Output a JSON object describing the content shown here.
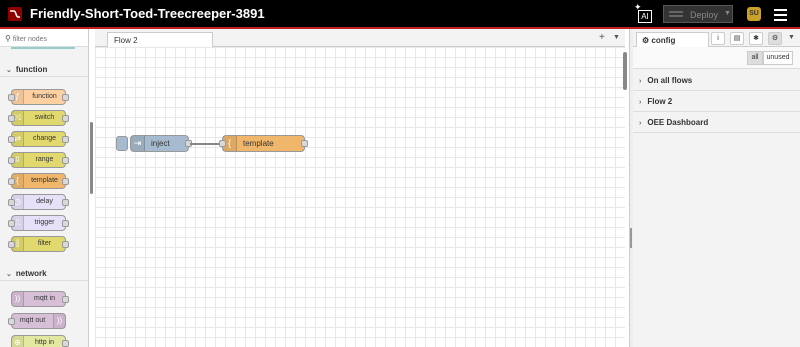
{
  "header": {
    "title": "Friendly-Short-Toed-Treecreeper-3891",
    "ai_label": "AI",
    "deploy_label": "Deploy",
    "user_initials": "SU",
    "accent": "#c02020"
  },
  "palette": {
    "filter_placeholder": "filter nodes",
    "categories": [
      {
        "label": "function",
        "nodes": [
          "function",
          "switch",
          "change",
          "range",
          "template",
          "delay",
          "trigger",
          "filter"
        ]
      },
      {
        "label": "network",
        "nodes": [
          "mqtt in",
          "mqtt out",
          "http in"
        ]
      }
    ],
    "colors": {
      "function": "#fdd0a2",
      "switch": "#e2d96e",
      "template": "#f0b76c",
      "delay": "#e6e0f8",
      "network": "#d8bfd8"
    }
  },
  "workspace": {
    "tabs": [
      {
        "label": "Flow 2"
      }
    ],
    "nodes": [
      {
        "label": "inject",
        "color": "#a6bbcf",
        "icon": "arrow-icon"
      },
      {
        "label": "template",
        "color": "#f0b76c",
        "icon": "brace-icon"
      }
    ]
  },
  "sidebar": {
    "active_tab": "config",
    "filter": {
      "all": "all",
      "unused": "unused"
    },
    "sections": [
      "On all flows",
      "Flow 2",
      "OEE Dashboard"
    ]
  }
}
